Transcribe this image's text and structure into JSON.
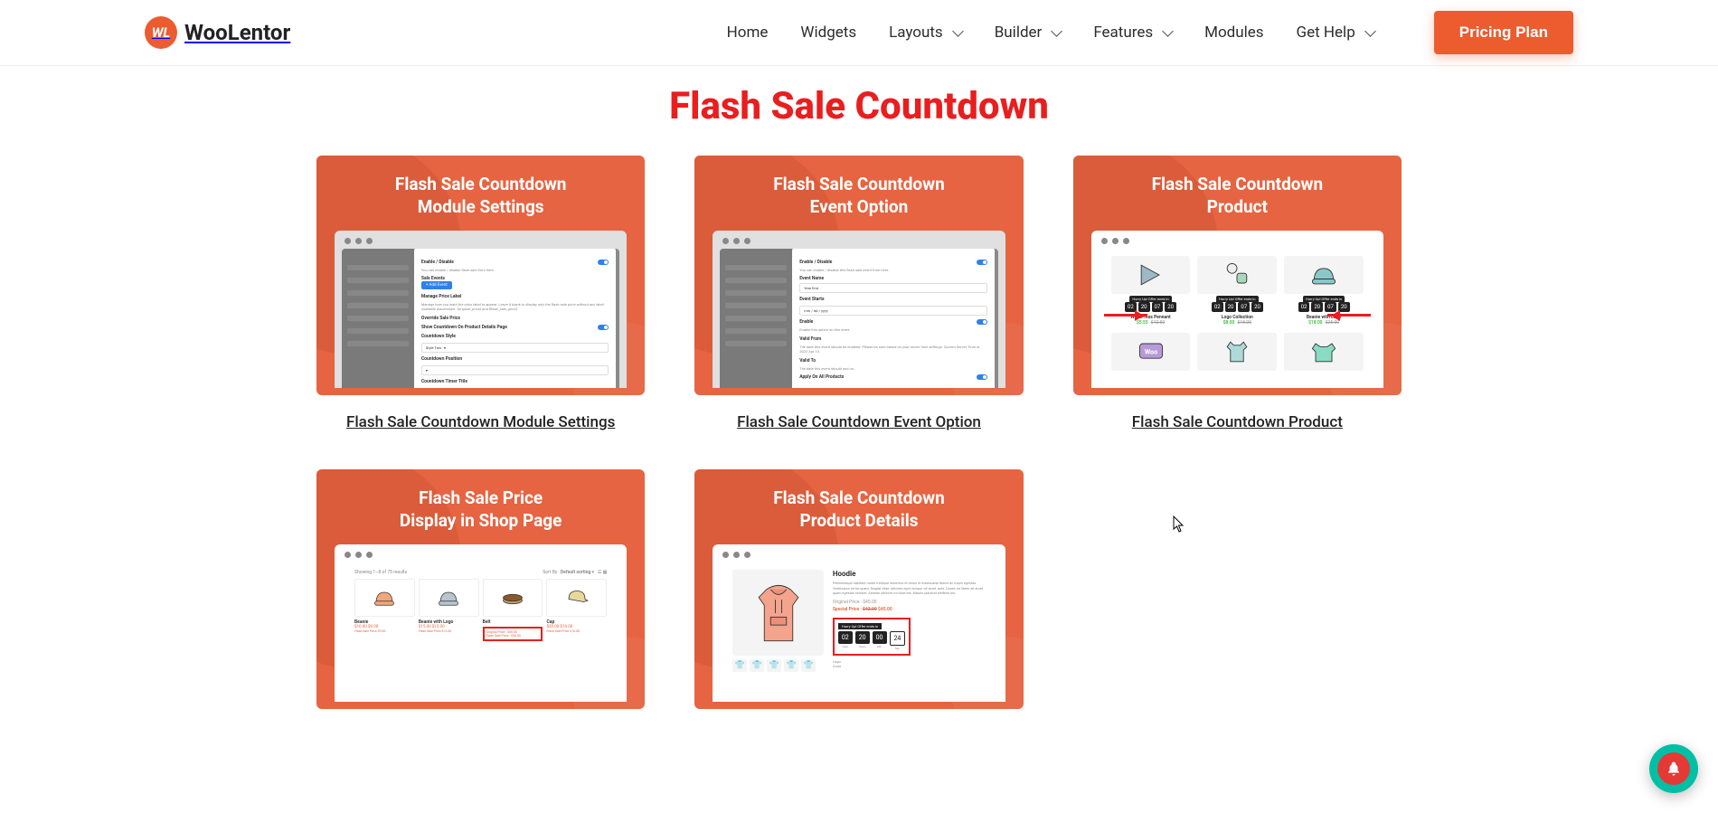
{
  "brand": {
    "mark": "WL",
    "name": "WooLentor"
  },
  "nav": {
    "home": "Home",
    "widgets": "Widgets",
    "layouts": "Layouts",
    "builder": "Builder",
    "features": "Features",
    "modules": "Modules",
    "gethelp": "Get Help",
    "pricing": "Pricing Plan"
  },
  "hero": {
    "title": "Flash Sale Countdown"
  },
  "cards": [
    {
      "title_l1": "Flash Sale Countdown",
      "title_l2": "Module Settings",
      "caption": "Flash Sale Countdown Module Settings",
      "type": "modal_settings",
      "settings": {
        "group1_title": "Enable / Disable",
        "group1_desc": "You can enable / disable flash sale from here.",
        "sale_events": "Sale Events",
        "add_event": "+ Add Event",
        "manage_price_title": "Manage Price Label",
        "manage_price_desc": "Manage how you want the price label to appear. Leave it blank to display only the flash sale price without any label. Available placeholder: {original_price} and {flash_sale_price}.",
        "override_sale": "Override Sale Price",
        "show_countdown_title": "Show Countdown On Product Details Page",
        "countdown_style": "Countdown Style",
        "countdown_position": "Countdown Position",
        "countdown_timer_title": "Countdown Timer Title"
      }
    },
    {
      "title_l1": "Flash Sale Countdown",
      "title_l2": "Event Option",
      "caption": "Flash Sale Countdown Event Option",
      "type": "modal_event",
      "event": {
        "group1_title": "Enable / Disable",
        "group1_desc": "You can enable / disable this flash sale event from here.",
        "event_name": "Event Name",
        "event_name_val": "Year End",
        "event_start": "Event Starts",
        "enable": "Enable",
        "enable_desc": "Enable this option on this event",
        "valid_from": "Valid From",
        "valid_from_desc": "The date this event should be enabled. Please be sure based on your server time settings. Current Server Time is: 2022 Apr 10.",
        "valid_to": "Valid To",
        "valid_to_desc": "The date this event should end on.",
        "apply_all": "Apply On All Products"
      }
    },
    {
      "title_l1": "Flash Sale Countdown",
      "title_l2": "Product",
      "caption": "Flash Sale Countdown Product",
      "type": "product_grid",
      "products": [
        {
          "name": "WordPress Pennant",
          "price": "$5.55",
          "old": "$10.50",
          "icon": "pennant",
          "cd": [
            "02",
            "20",
            "07",
            "20"
          ]
        },
        {
          "name": "Logo Collection",
          "price": "$8.00",
          "old": "$18.00",
          "icon": "logo-set",
          "cd": [
            "02",
            "20",
            "07",
            "20"
          ]
        },
        {
          "name": "Beanie with Logo",
          "price": "$18.00",
          "old": "$25.00",
          "icon": "beanie-logo",
          "cd": [
            "02",
            "20",
            "07",
            "20"
          ]
        },
        {
          "name": "",
          "price": "",
          "old": "",
          "icon": "woo",
          "cd": []
        },
        {
          "name": "",
          "price": "",
          "old": "",
          "icon": "polo",
          "cd": []
        },
        {
          "name": "",
          "price": "",
          "old": "",
          "icon": "sleeve",
          "cd": []
        }
      ]
    },
    {
      "title_l1": "Flash Sale Price",
      "title_l2": "Display in Shop Page",
      "caption": "",
      "type": "shop_page",
      "shop": {
        "results": "Showing 1–8 of 75 results",
        "sort_label": "Sort By :",
        "sort_val": "Default sorting",
        "items": [
          {
            "name": "Beanie",
            "price": "$10.00 $9.00",
            "flash": "Flash Sale Price $9.00",
            "icon": "beanie-orange"
          },
          {
            "name": "Beanie with Logo",
            "price": "$15.00 $12.00",
            "flash": "Flash Sale Price $12.00",
            "icon": "beanie-gray"
          },
          {
            "name": "Belt",
            "price": "$55.00",
            "flash_l1": "Original Price : $55.00",
            "flash_l2": "Flash Sale Price : $50.00",
            "icon": "belt",
            "highlight": true
          },
          {
            "name": "Cap",
            "price": "$20.00 $16.00",
            "flash": "Flash Sale Price $16.00",
            "icon": "cap"
          }
        ]
      }
    },
    {
      "title_l1": "Flash Sale Countdown",
      "title_l2": "Product Details",
      "caption": "",
      "type": "product_detail",
      "detail": {
        "title": "Hoodie",
        "desc": "Pellentesque habitant morbi tristique senectus et netus et malesuada fames ac turpis egestas. Vestibulum tortor quam, feugiat vitae, ultricies eget, tempor sit amet, ante. Donec eu libero sit amet quam egestas semper. Aenean ultricies mi vitae est. Mauris placerat eleifend leo.",
        "orig_label": "Original Price :",
        "orig": "$45.00",
        "spec_label": "Special Price :",
        "spec_old": "$42.00",
        "spec": "$45.00",
        "cd_label": "Hurry Up! Offer ends in",
        "cd": [
          {
            "num": "02",
            "unit": "Days"
          },
          {
            "num": "20",
            "unit": "Hours"
          },
          {
            "num": "00",
            "unit": "Min"
          },
          {
            "num": "24",
            "unit": "Sec",
            "white": true
          }
        ],
        "opts": [
          "Logo",
          "Color"
        ]
      }
    }
  ]
}
